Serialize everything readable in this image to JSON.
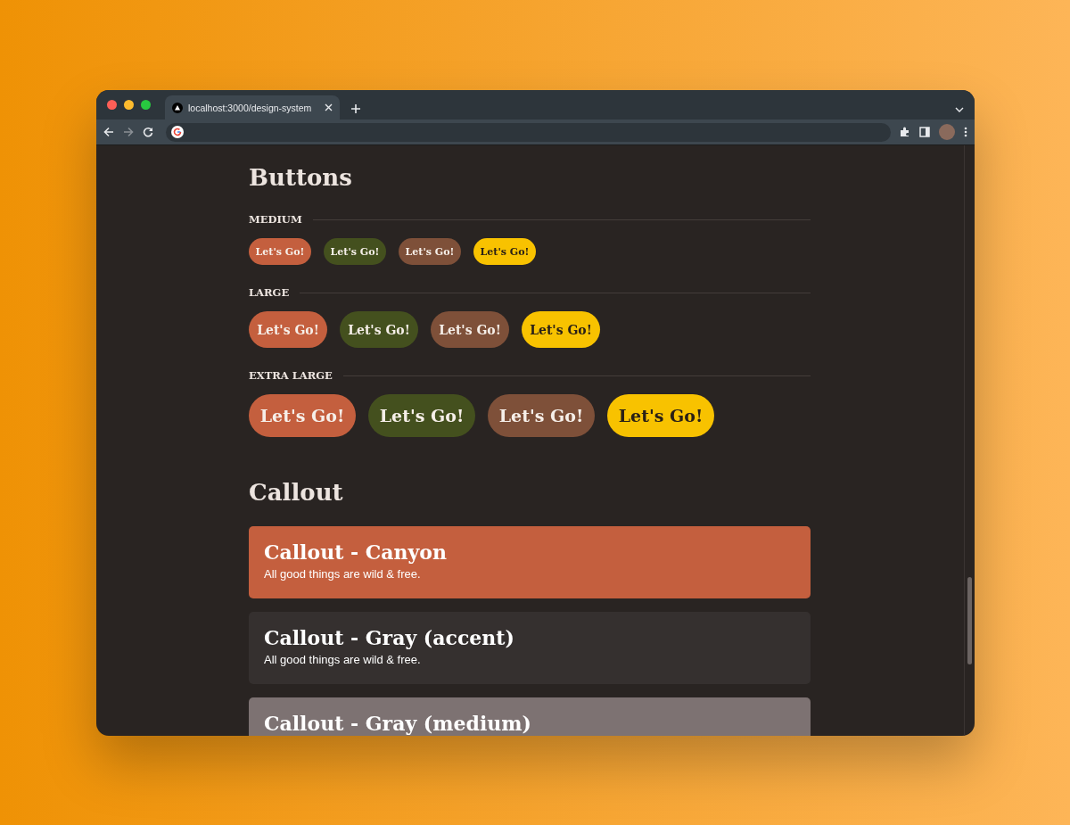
{
  "browser": {
    "tab_title": "localhost:3000/design-system"
  },
  "buttons_section": {
    "title": "Buttons",
    "groups": [
      {
        "label": "MEDIUM",
        "kind": "medium",
        "buttons": [
          {
            "label": "Let's Go!",
            "color": "#c45f3e"
          },
          {
            "label": "Let's Go!",
            "color": "#44501e"
          },
          {
            "label": "Let's Go!",
            "color": "#7e5039"
          },
          {
            "label": "Let's Go!",
            "color": "#f8c200"
          }
        ]
      },
      {
        "label": "LARGE",
        "kind": "large",
        "buttons": [
          {
            "label": "Let's Go!",
            "color": "#c45f3e"
          },
          {
            "label": "Let's Go!",
            "color": "#44501e"
          },
          {
            "label": "Let's Go!",
            "color": "#7e5039"
          },
          {
            "label": "Let's Go!",
            "color": "#f8c200"
          }
        ]
      },
      {
        "label": "EXTRA LARGE",
        "kind": "xlarge",
        "buttons": [
          {
            "label": "Let's Go!",
            "color": "#c45f3e"
          },
          {
            "label": "Let's Go!",
            "color": "#44501e"
          },
          {
            "label": "Let's Go!",
            "color": "#7e5039"
          },
          {
            "label": "Let's Go!",
            "color": "#f8c200"
          }
        ]
      }
    ]
  },
  "callout_section": {
    "title": "Callout",
    "callouts": [
      {
        "title": "Callout - Canyon",
        "text": "All good things are wild & free.",
        "color": "#c45f3e"
      },
      {
        "title": "Callout - Gray (accent)",
        "text": "All good things are wild & free.",
        "color": "#35302f"
      },
      {
        "title": "Callout - Gray (medium)",
        "color": "#7d7272"
      }
    ]
  }
}
